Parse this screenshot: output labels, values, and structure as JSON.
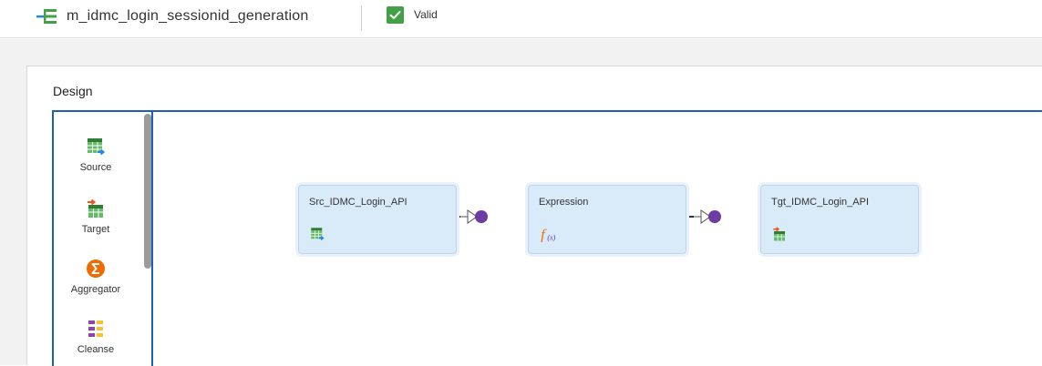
{
  "header": {
    "title": "m_idmc_login_sessionid_generation",
    "status": "Valid",
    "status_color": "#43a047",
    "icon": "mapping-icon"
  },
  "design": {
    "title": "Design",
    "accent_color": "#1f5fb8"
  },
  "palette": {
    "items": [
      {
        "label": "Source",
        "icon": "source-icon"
      },
      {
        "label": "Target",
        "icon": "target-icon"
      },
      {
        "label": "Aggregator",
        "icon": "aggregator-icon"
      },
      {
        "label": "Cleanse",
        "icon": "cleanse-icon"
      }
    ]
  },
  "canvas": {
    "nodes": [
      {
        "label": "Src_IDMC_Login_API",
        "icon": "source-icon"
      },
      {
        "label": "Expression",
        "icon": "expression-icon"
      },
      {
        "label": "Tgt_IDMC_Login_API",
        "icon": "target-icon"
      }
    ],
    "node_fill": "#d9eaf9",
    "link_color": "#6a3ea1"
  }
}
